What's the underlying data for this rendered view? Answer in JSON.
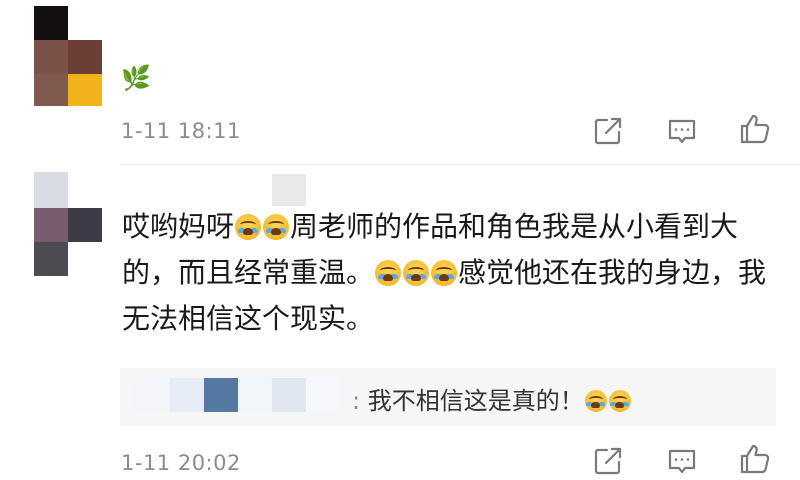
{
  "comments": [
    {
      "leaf_emoji": "🌿",
      "timestamp": "1-11 18:11"
    },
    {
      "text_parts": [
        "哎哟妈呀",
        "周老师的作品和角色我是从小看到大的，而且经常重温。",
        "感觉他还在我的身边，我无法相信这个现实。"
      ],
      "reply": {
        "separator": ":",
        "text": "我不相信这是真的！"
      },
      "timestamp": "1-11 20:02"
    }
  ],
  "icons": {
    "share": "share-icon",
    "comment": "comment-icon",
    "like": "thumbs-up-icon",
    "crying": "crying-emoji-icon"
  },
  "colors": {
    "text": "#1a1a1a",
    "muted": "#8c8c8c",
    "reply_bg": "#f6f6f6",
    "icon": "#7a7a7a"
  }
}
